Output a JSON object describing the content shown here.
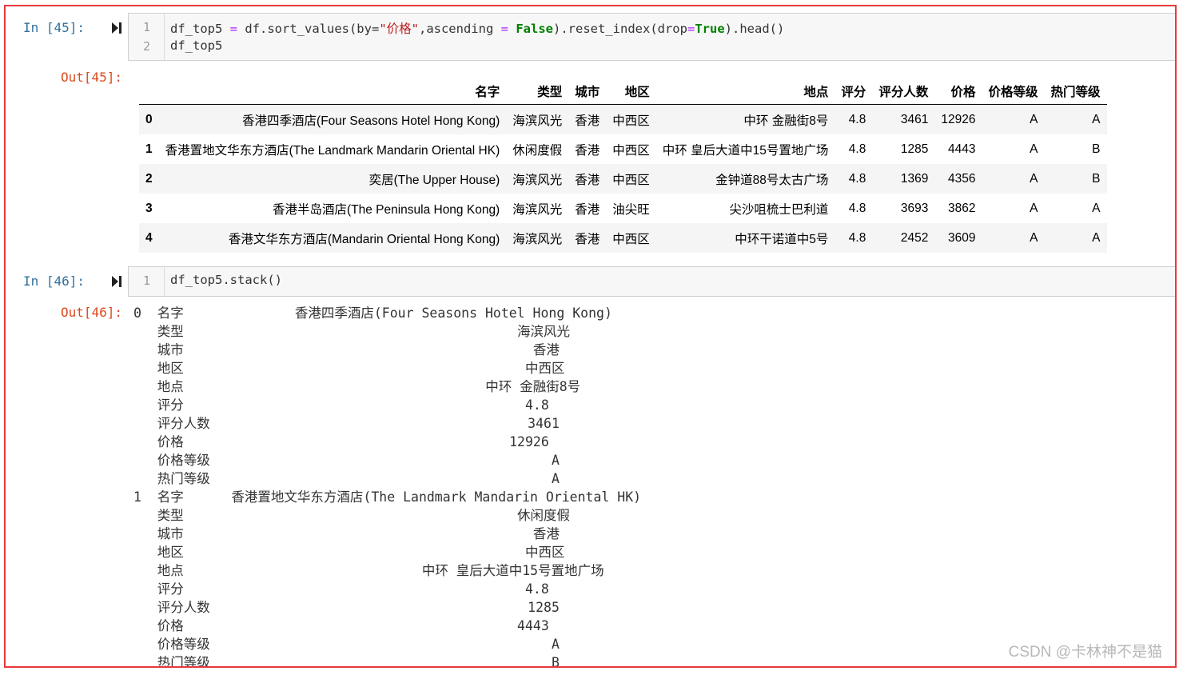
{
  "cell45": {
    "in_prompt": "In  [45]:",
    "out_prompt": "Out[45]:",
    "line_numbers": [
      "1",
      "2"
    ],
    "code": {
      "l1_a": "df_top5 ",
      "l1_eq": "=",
      "l1_b": " df.sort_values(by=",
      "l1_str": "\"价格\"",
      "l1_c": ",ascending ",
      "l1_eq2": "=",
      "l1_sp": " ",
      "l1_false": "False",
      "l1_d": ").reset_index(drop",
      "l1_eq3": "=",
      "l1_true": "True",
      "l1_e": ").head()",
      "l2": "df_top5"
    },
    "table": {
      "columns": [
        "",
        "名字",
        "类型",
        "城市",
        "地区",
        "地点",
        "评分",
        "评分人数",
        "价格",
        "价格等级",
        "热门等级"
      ],
      "rows": [
        [
          "0",
          "香港四季酒店(Four Seasons Hotel Hong Kong)",
          "海滨风光",
          "香港",
          "中西区",
          "中环 金融街8号",
          "4.8",
          "3461",
          "12926",
          "A",
          "A"
        ],
        [
          "1",
          "香港置地文华东方酒店(The Landmark Mandarin Oriental HK)",
          "休闲度假",
          "香港",
          "中西区",
          "中环 皇后大道中15号置地广场",
          "4.8",
          "1285",
          "4443",
          "A",
          "B"
        ],
        [
          "2",
          "奕居(The Upper House)",
          "海滨风光",
          "香港",
          "中西区",
          "金钟道88号太古广场",
          "4.8",
          "1369",
          "4356",
          "A",
          "B"
        ],
        [
          "3",
          "香港半岛酒店(The Peninsula Hong Kong)",
          "海滨风光",
          "香港",
          "油尖旺",
          "尖沙咀梳士巴利道",
          "4.8",
          "3693",
          "3862",
          "A",
          "A"
        ],
        [
          "4",
          "香港文华东方酒店(Mandarin Oriental Hong Kong)",
          "海滨风光",
          "香港",
          "中西区",
          "中环干诺道中5号",
          "4.8",
          "2452",
          "3609",
          "A",
          "A"
        ]
      ]
    }
  },
  "cell46": {
    "in_prompt": "In  [46]:",
    "out_prompt": "Out[46]:",
    "line_number": "1",
    "code": "df_top5.stack()",
    "output_lines": [
      "0  名字              香港四季酒店(Four Seasons Hotel Hong Kong)",
      "   类型                                          海滨风光",
      "   城市                                            香港",
      "   地区                                           中西区",
      "   地点                                      中环 金融街8号",
      "   评分                                           4.8",
      "   评分人数                                        3461",
      "   价格                                         12926",
      "   价格等级                                           A",
      "   热门等级                                           A",
      "1  名字      香港置地文华东方酒店(The Landmark Mandarin Oriental HK)",
      "   类型                                          休闲度假",
      "   城市                                            香港",
      "   地区                                           中西区",
      "   地点                              中环 皇后大道中15号置地广场",
      "   评分                                           4.8",
      "   评分人数                                        1285",
      "   价格                                          4443",
      "   价格等级                                           A",
      "   热门等级                                           B"
    ]
  },
  "watermark": "CSDN @卡林神不是猫",
  "colors": {
    "frame_border": "#e8383d",
    "in_prompt": "#30709e",
    "out_prompt": "#d84a1f",
    "keyword": "#008000",
    "string": "#ba2121"
  }
}
